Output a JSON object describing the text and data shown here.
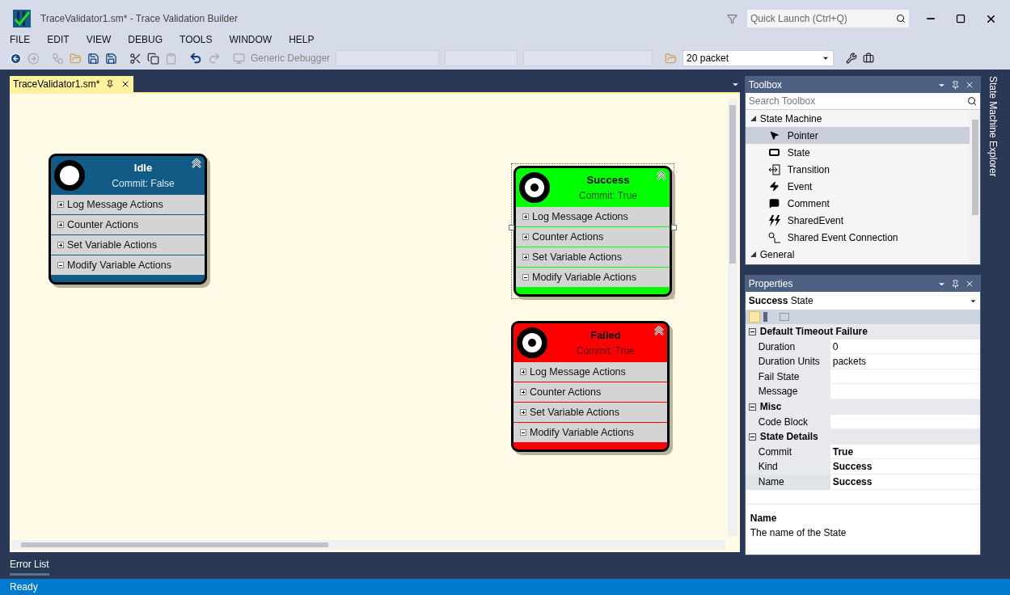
{
  "window": {
    "title": "TraceValidator1.sm* - Trace Validation Builder"
  },
  "quick_launch": {
    "placeholder": "Quick Launch (Ctrl+Q)"
  },
  "menu": [
    "FILE",
    "EDIT",
    "VIEW",
    "DEBUG",
    "TOOLS",
    "WINDOW",
    "HELP"
  ],
  "toolbar": {
    "debugger": "Generic Debugger",
    "packet_combo": "20 packet"
  },
  "document_tab": {
    "label": "TraceValidator1.sm*",
    "selected": true
  },
  "states": [
    {
      "name": "Idle",
      "commit": "Commit: False",
      "kind": "initial",
      "color": "#135b87",
      "selected": false,
      "sections": [
        {
          "label": "Log Message Actions",
          "expanded": false
        },
        {
          "label": "Counter Actions",
          "expanded": false
        },
        {
          "label": "Set Variable Actions",
          "expanded": false
        },
        {
          "label": "Modify Variable Actions",
          "expanded": true
        }
      ]
    },
    {
      "name": "Success",
      "commit": "Commit: True",
      "kind": "final",
      "color": "#00ff00",
      "selected": true,
      "sections": [
        {
          "label": "Log Message Actions",
          "expanded": false
        },
        {
          "label": "Counter Actions",
          "expanded": false
        },
        {
          "label": "Set Variable Actions",
          "expanded": false
        },
        {
          "label": "Modify Variable Actions",
          "expanded": true
        }
      ]
    },
    {
      "name": "Failed",
      "commit": "Commit: True",
      "kind": "final",
      "color": "#ff0000",
      "selected": false,
      "sections": [
        {
          "label": "Log Message Actions",
          "expanded": false
        },
        {
          "label": "Counter Actions",
          "expanded": false
        },
        {
          "label": "Set Variable Actions",
          "expanded": false
        },
        {
          "label": "Modify Variable Actions",
          "expanded": true
        }
      ]
    }
  ],
  "toolbox": {
    "title": "Toolbox",
    "search_placeholder": "Search Toolbox",
    "groups": [
      {
        "label": "State Machine",
        "expanded": true,
        "items": [
          {
            "label": "Pointer",
            "selected": true
          },
          {
            "label": "State",
            "selected": false
          },
          {
            "label": "Transition",
            "selected": false
          },
          {
            "label": "Event",
            "selected": false
          },
          {
            "label": "Comment",
            "selected": false
          },
          {
            "label": "SharedEvent",
            "selected": false
          },
          {
            "label": "Shared Event Connection",
            "selected": false
          }
        ]
      },
      {
        "label": "General",
        "expanded": true
      }
    ]
  },
  "properties": {
    "title": "Properties",
    "object_name": "Success",
    "object_type": "State",
    "categories": [
      {
        "label": "Default Timeout Failure",
        "expanded": true,
        "rows": [
          {
            "name": "Duration",
            "value": "0",
            "modified": false,
            "selected": false
          },
          {
            "name": "Duration Units",
            "value": "packets",
            "modified": false,
            "selected": false
          },
          {
            "name": "Fail State",
            "modified": false,
            "selected": false
          },
          {
            "name": "Message",
            "modified": false,
            "selected": false
          }
        ]
      },
      {
        "label": "Misc",
        "expanded": true,
        "rows": [
          {
            "name": "Code Block",
            "modified": false,
            "selected": false
          }
        ]
      },
      {
        "label": "State Details",
        "expanded": true,
        "rows": [
          {
            "name": "Commit",
            "value": "True",
            "modified": true,
            "selected": false
          },
          {
            "name": "Kind",
            "value": "Success",
            "modified": true,
            "selected": false
          },
          {
            "name": "Name",
            "value": "Success",
            "modified": true,
            "selected": true
          }
        ]
      }
    ],
    "description": {
      "title": "Name",
      "text": "The name of the State"
    }
  },
  "side_tab": "State Machine Explorer",
  "bottom_tab": "Error List",
  "status": "Ready"
}
